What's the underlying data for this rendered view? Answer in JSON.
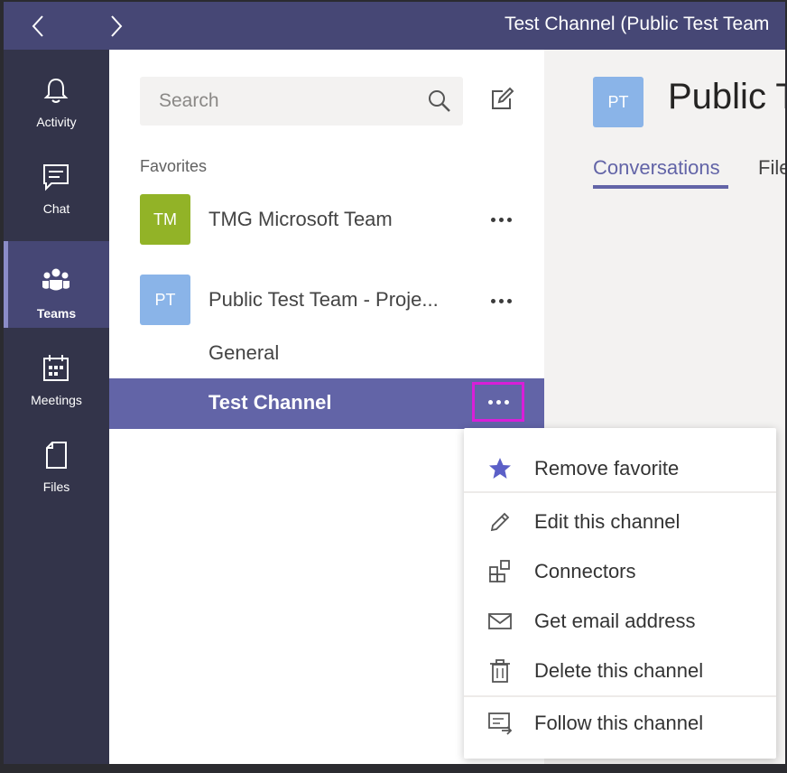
{
  "titlebar": {
    "title": "Test Channel (Public Test Team"
  },
  "rail": {
    "items": [
      {
        "label": "Activity",
        "icon": "bell-icon"
      },
      {
        "label": "Chat",
        "icon": "chat-icon"
      },
      {
        "label": "Teams",
        "icon": "teams-icon",
        "active": true
      },
      {
        "label": "Meetings",
        "icon": "calendar-icon"
      },
      {
        "label": "Files",
        "icon": "file-icon"
      }
    ]
  },
  "search": {
    "placeholder": "Search"
  },
  "favorites": {
    "label": "Favorites",
    "teams": [
      {
        "initials": "TM",
        "name": "TMG Microsoft Team",
        "color": "#92b327"
      },
      {
        "initials": "PT",
        "name": "Public Test Team - Proje...",
        "color": "#8ab4e8"
      }
    ],
    "channels": [
      {
        "name": "General"
      },
      {
        "name": "Test Channel",
        "selected": true
      }
    ]
  },
  "main": {
    "avatar_initials": "PT",
    "title": "Public T",
    "tabs": [
      {
        "label": "Conversations",
        "active": true
      },
      {
        "label": "File"
      }
    ]
  },
  "context_menu": {
    "items": [
      {
        "label": "Remove favorite",
        "icon": "star-icon"
      },
      {
        "label": "Edit this channel",
        "icon": "pencil-icon"
      },
      {
        "label": "Connectors",
        "icon": "connectors-icon"
      },
      {
        "label": "Get email address",
        "icon": "envelope-icon"
      },
      {
        "label": "Delete this channel",
        "icon": "trash-icon"
      },
      {
        "label": "Follow this channel",
        "icon": "follow-icon"
      }
    ]
  },
  "colors": {
    "titlebar": "#464775",
    "rail": "#33344a",
    "accent": "#6264a7",
    "highlight_border": "#d81fd8"
  }
}
